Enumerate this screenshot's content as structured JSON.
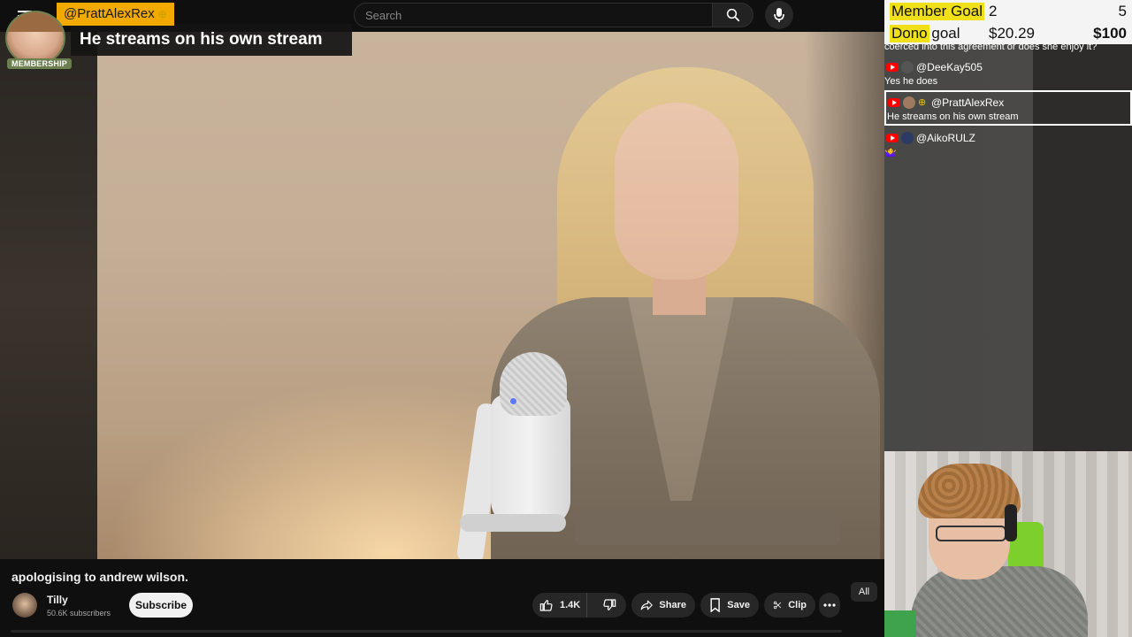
{
  "search": {
    "placeholder": "Search"
  },
  "chat_popup": {
    "username": "@PrattAlexRex",
    "message": "He streams on his own stream",
    "membership_label": "MEMBERSHIP"
  },
  "goals": {
    "member_goal": {
      "label": "Member Goal",
      "current": "2",
      "target": "5"
    },
    "dono_goal": {
      "label": "Dono goal",
      "current": "$20.29",
      "target": "$100"
    }
  },
  "chat": {
    "cut_line": "coerced into this agreement or does she enjoy it?",
    "messages": [
      {
        "user": "@DeeKay505",
        "text": "Yes he does",
        "highlight": false
      },
      {
        "user": "@PrattAlexRex",
        "text": "He streams on his own stream",
        "highlight": true
      },
      {
        "user": "@AikoRULZ",
        "text": "🤷‍♀️",
        "highlight": false
      }
    ]
  },
  "video": {
    "title": "apologising to andrew wilson.",
    "channel": "Tilly",
    "subscribers": "50.6K subscribers",
    "subscribe_label": "Subscribe",
    "likes": "1.4K",
    "share_label": "Share",
    "save_label": "Save",
    "clip_label": "Clip",
    "all_chip": "All"
  },
  "colors": {
    "accent_red": "#ff0000",
    "goal_highlight": "#f0e01a",
    "username_bg": "#f2a900",
    "membership_green": "#6b7f4f"
  }
}
